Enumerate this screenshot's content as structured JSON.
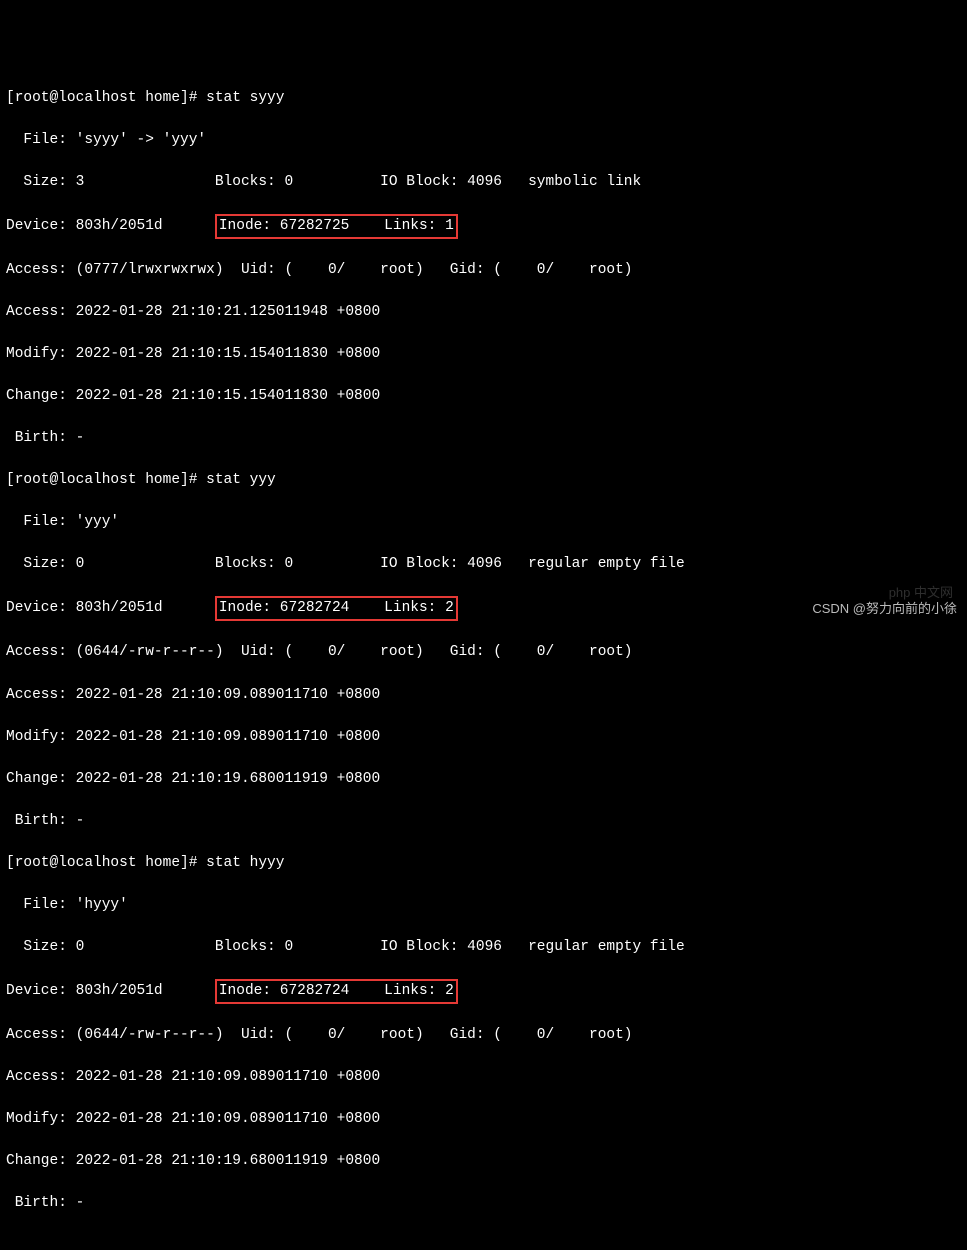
{
  "prompts": {
    "p1": "[root@localhost home]# ",
    "cmd1": "stat syyy",
    "p2": "[root@localhost home]# ",
    "cmd2": "stat yyy",
    "p3": "[root@localhost home]# ",
    "cmd3": "stat hyyy"
  },
  "stat1": {
    "file": "  File: 'syyy' -> 'yyy'",
    "size": "  Size: 3               Blocks: 0          IO Block: 4096   symbolic link",
    "dev_a": "Device: 803h/2051d      ",
    "inode": "Inode: 67282725    Links: 1",
    "acc_p": "Access: (0777/lrwxrwxrwx)  Uid: (    0/    root)   Gid: (    0/    root)",
    "acc": "Access: 2022-01-28 21:10:21.125011948 +0800",
    "mod": "Modify: 2022-01-28 21:10:15.154011830 +0800",
    "chg": "Change: 2022-01-28 21:10:15.154011830 +0800",
    "birth": " Birth: -"
  },
  "stat2": {
    "file": "  File: 'yyy'",
    "size": "  Size: 0               Blocks: 0          IO Block: 4096   regular empty file",
    "dev_a": "Device: 803h/2051d      ",
    "inode": "Inode: 67282724    Links: 2",
    "acc_p": "Access: (0644/-rw-r--r--)  Uid: (    0/    root)   Gid: (    0/    root)",
    "acc": "Access: 2022-01-28 21:10:09.089011710 +0800",
    "mod": "Modify: 2022-01-28 21:10:09.089011710 +0800",
    "chg": "Change: 2022-01-28 21:10:19.680011919 +0800",
    "birth": " Birth: -"
  },
  "stat3": {
    "file": "  File: 'hyyy'",
    "size": "  Size: 0               Blocks: 0          IO Block: 4096   regular empty file",
    "dev_a": "Device: 803h/2051d      ",
    "inode": "Inode: 67282724    Links: 2",
    "acc_p": "Access: (0644/-rw-r--r--)  Uid: (    0/    root)   Gid: (    0/    root)",
    "acc": "Access: 2022-01-28 21:10:09.089011710 +0800",
    "mod": "Modify: 2022-01-28 21:10:09.089011710 +0800",
    "chg": "Change: 2022-01-28 21:10:19.680011919 +0800",
    "birth": " Birth: -"
  },
  "footer": "CSDN @努力向前的小徐",
  "watermark": "php 中文网"
}
